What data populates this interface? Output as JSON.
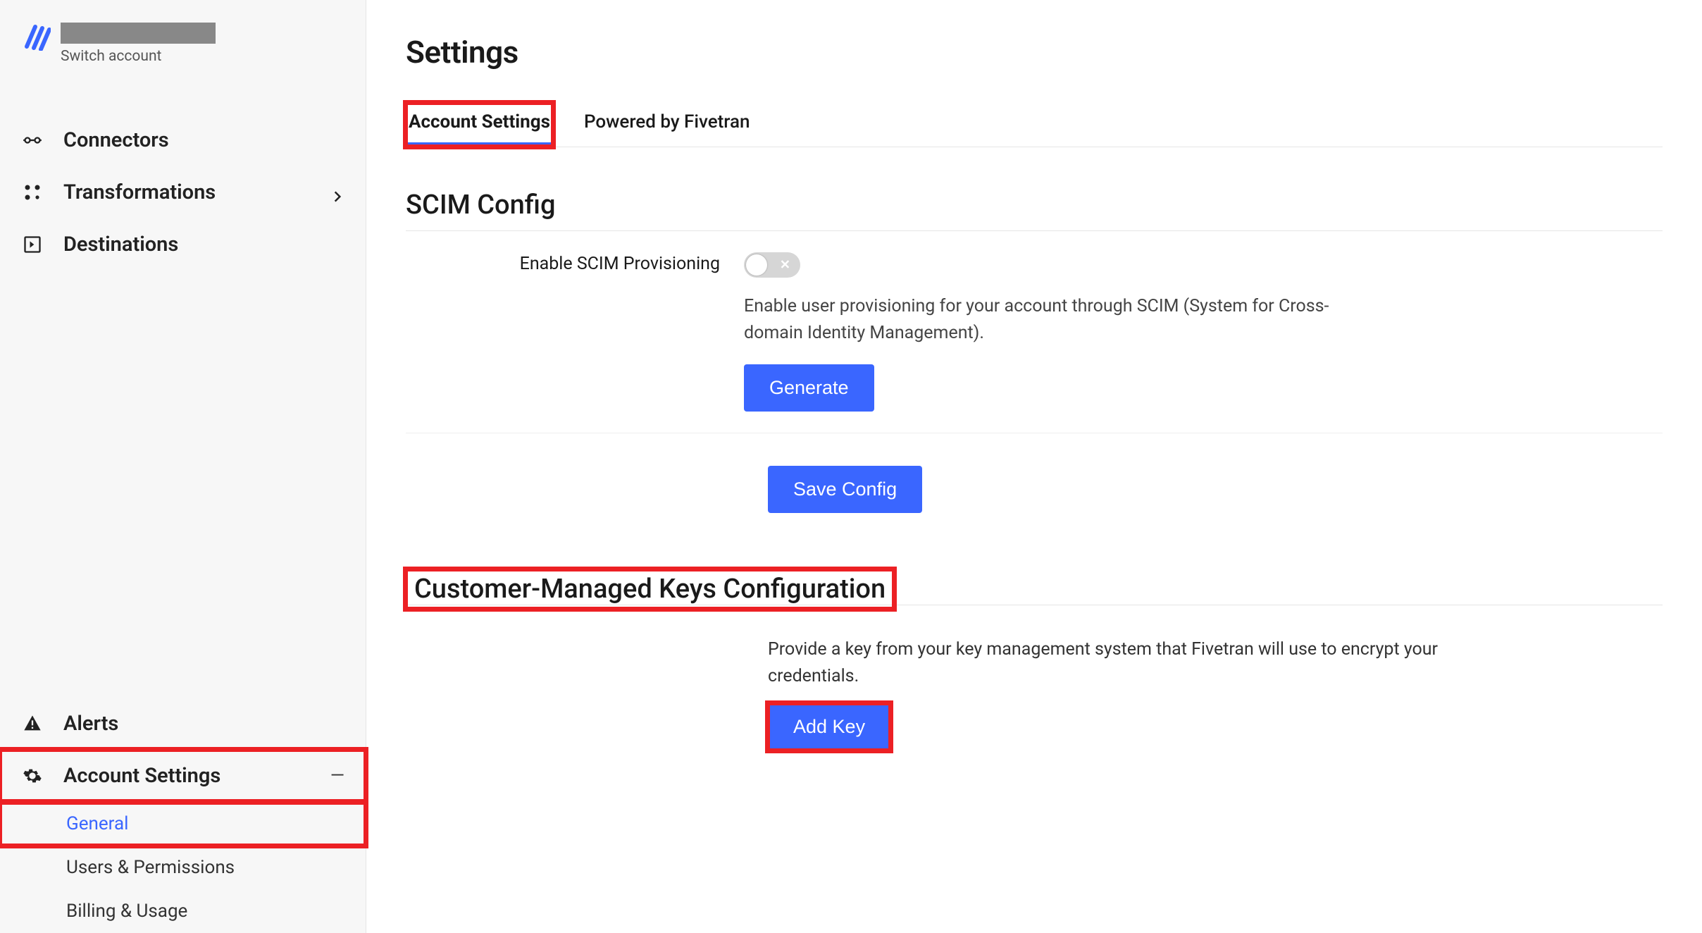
{
  "brand": {
    "switch_label": "Switch account"
  },
  "sidebar": {
    "items": [
      {
        "label": "Connectors"
      },
      {
        "label": "Transformations"
      },
      {
        "label": "Destinations"
      }
    ],
    "bottom_items": [
      {
        "label": "Alerts"
      },
      {
        "label": "Account Settings"
      }
    ],
    "sub_items": [
      {
        "label": "General"
      },
      {
        "label": "Users & Permissions"
      },
      {
        "label": "Billing & Usage"
      }
    ]
  },
  "main": {
    "title": "Settings",
    "tabs": [
      {
        "label": "Account Settings"
      },
      {
        "label": "Powered by Fivetran"
      }
    ],
    "scim": {
      "heading": "SCIM Config",
      "enable_label": "Enable SCIM Provisioning",
      "enable_help": "Enable user provisioning for your account through SCIM (System for Cross-domain Identity Management).",
      "generate_btn": "Generate",
      "save_btn": "Save Config"
    },
    "cmk": {
      "heading": "Customer-Managed Keys Configuration",
      "description": "Provide a key from your key management system that Fivetran will use to encrypt your credentials.",
      "add_btn": "Add Key"
    }
  },
  "colors": {
    "accent": "#3a66ff",
    "highlight": "#ec2024"
  }
}
